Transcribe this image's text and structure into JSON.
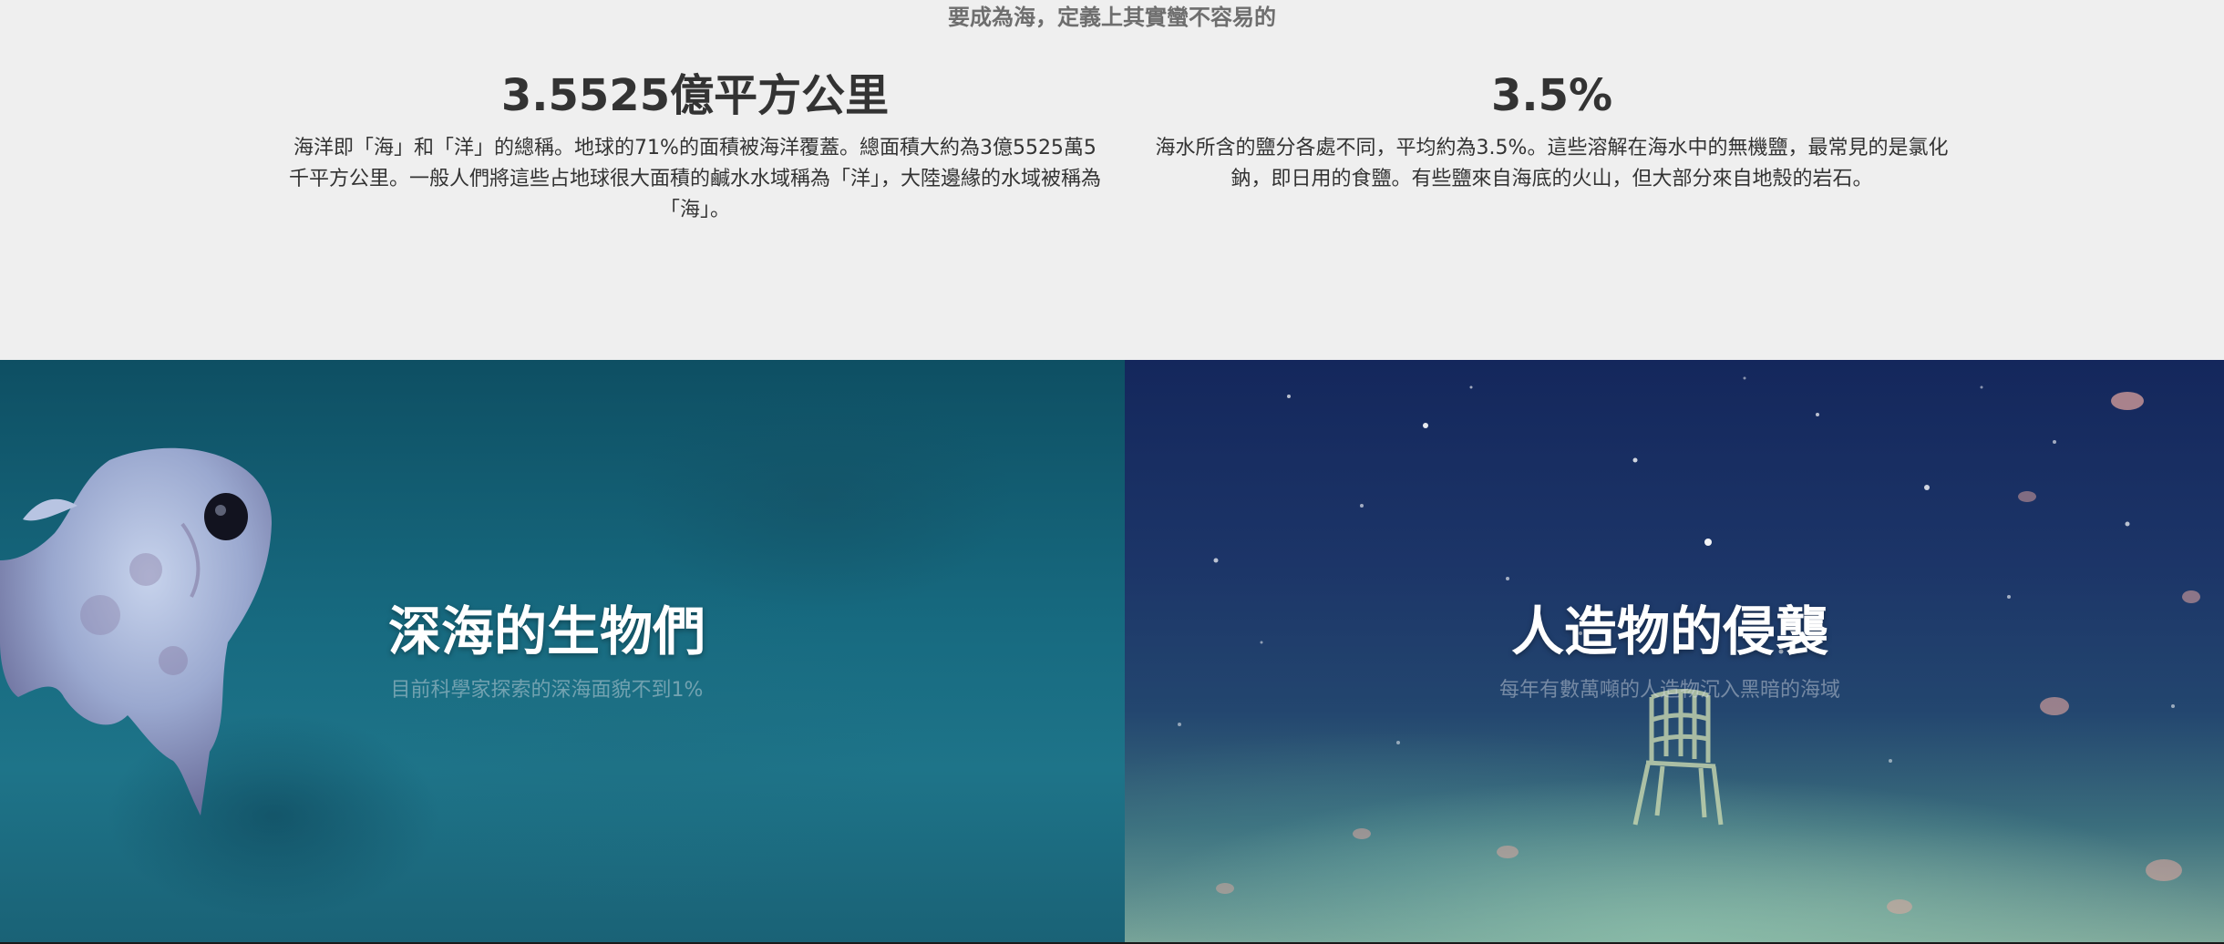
{
  "stats": {
    "tagline": "要成為海，定義上其實蠻不容易的",
    "area": {
      "value": "3.5525億平方公里",
      "description": "海洋即「海」和「洋」的總稱。地球的71%的面積被海洋覆蓋。總面積大約為3億5525萬5千平方公里。一般人們將這些占地球很大面積的鹹水水域稱為「洋」，大陸邊緣的水域被稱為「海」。"
    },
    "salinity": {
      "value": "3.5%",
      "description": "海水所含的鹽分各處不同，平均約為3.5%。這些溶解在海水中的無機鹽，最常見的是氯化鈉，即日用的食鹽。有些鹽來自海底的火山，但大部分來自地殼的岩石。"
    }
  },
  "panels": {
    "deep_sea": {
      "title": "深海的生物們",
      "subtitle": "目前科學家探索的深海面貌不到1%",
      "icon": "dumbo-octopus-icon"
    },
    "artifacts": {
      "title": "人造物的侵襲",
      "subtitle": "每年有數萬噸的人造物沉入黑暗的海域",
      "icon": "sunken-chair-icon"
    }
  },
  "colors": {
    "background": "#efefef",
    "text": "#333333",
    "tagline": "#6e6e6e",
    "deep_sea_bg": "#176a80",
    "artifacts_bg": "#1c3568"
  }
}
